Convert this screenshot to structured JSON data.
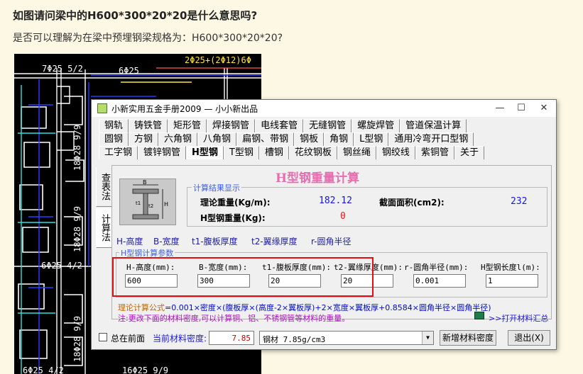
{
  "post": {
    "title": "如图请问梁中的H600*300*20*20是什么意思吗?",
    "subtitle": "是否可以理解为在梁中预埋钢梁规格为：H600*300*20*20?"
  },
  "cad": {
    "labels": [
      "7Φ25 5/2",
      "6Φ25",
      "2Φ25+(2Φ12)6Φ",
      "18Φ28 9/9",
      "18Φ28 9/9",
      "6Φ25 4/2",
      "18Φ28 9/9",
      "6Φ25 4/2",
      "16Φ25 9/9"
    ]
  },
  "window": {
    "title": "小新实用五金手册2009 — 小小新出品",
    "controls": {
      "minimize": "—",
      "maximize": "☐",
      "close": "✕"
    },
    "tabs_row1": [
      "钢轨",
      "铸铁管",
      "矩形管",
      "焊接钢管",
      "电线套管",
      "无缝钢管",
      "螺旋焊管",
      "管道保温计算"
    ],
    "tabs_row2": [
      "圆钢",
      "方钢",
      "六角钢",
      "八角钢",
      "扁钢、带钢",
      "钢板",
      "角钢",
      "L型钢",
      "通用冷弯开口型钢"
    ],
    "tabs_row3": [
      "工字钢",
      "镀锌钢管",
      "H型钢",
      "T型钢",
      "槽钢",
      "花纹钢板",
      "钢丝绳",
      "钢绞线",
      "紫铜管",
      "关于"
    ],
    "active_tab": "H型钢",
    "side_tabs": [
      "查表法",
      "计算法"
    ]
  },
  "panel": {
    "title": "H型钢重量计算",
    "results_group": "计算结果显示",
    "weight_label": "理论重量(Kg/m):",
    "weight_value": "182.12",
    "area_label": "截面面积(cm2):",
    "area_value": "232",
    "hweight_label": "H型钢重量(Kg):",
    "hweight_value": "0",
    "param_names": [
      "H-高度",
      "B-宽度",
      "t1-腹板厚度",
      "t2-翼缘厚度",
      "r-圆角半径"
    ],
    "params_group": "H型钢计算参数",
    "param_labels": [
      "H-高度(mm):",
      "B-宽度(mm):",
      "t1-腹板厚度(mm):",
      "t2-翼缘厚度(mm):",
      "r-圆角半径(mm):",
      "H型钢长度l(m):"
    ],
    "param_values": [
      "600",
      "300",
      "20",
      "20",
      "0.001",
      "1"
    ],
    "formula_label": "理论计算公式",
    "formula": "=0.001×密度×(腹板厚×(高度-2×翼板厚)+2×宽度×翼板厚+0.8584×圆角半径×圆角半径)",
    "note": "注:更改下面的材料密度,可以计算铜、铝、不锈钢管等材料的重量。",
    "open_link": ">>打开材料汇总"
  },
  "bottom": {
    "always_on_top": "总在前面",
    "density_label": "当前材料密度:",
    "density_value": "7.85",
    "material": "钢材 7.85g/cm3",
    "add_button": "新增材料密度",
    "exit_button": "退出(X)"
  },
  "colors": {
    "title_pink": "#e46fae",
    "value_blue": "#1616d8",
    "value_red": "#ff1010",
    "highlight": "#e01010"
  }
}
